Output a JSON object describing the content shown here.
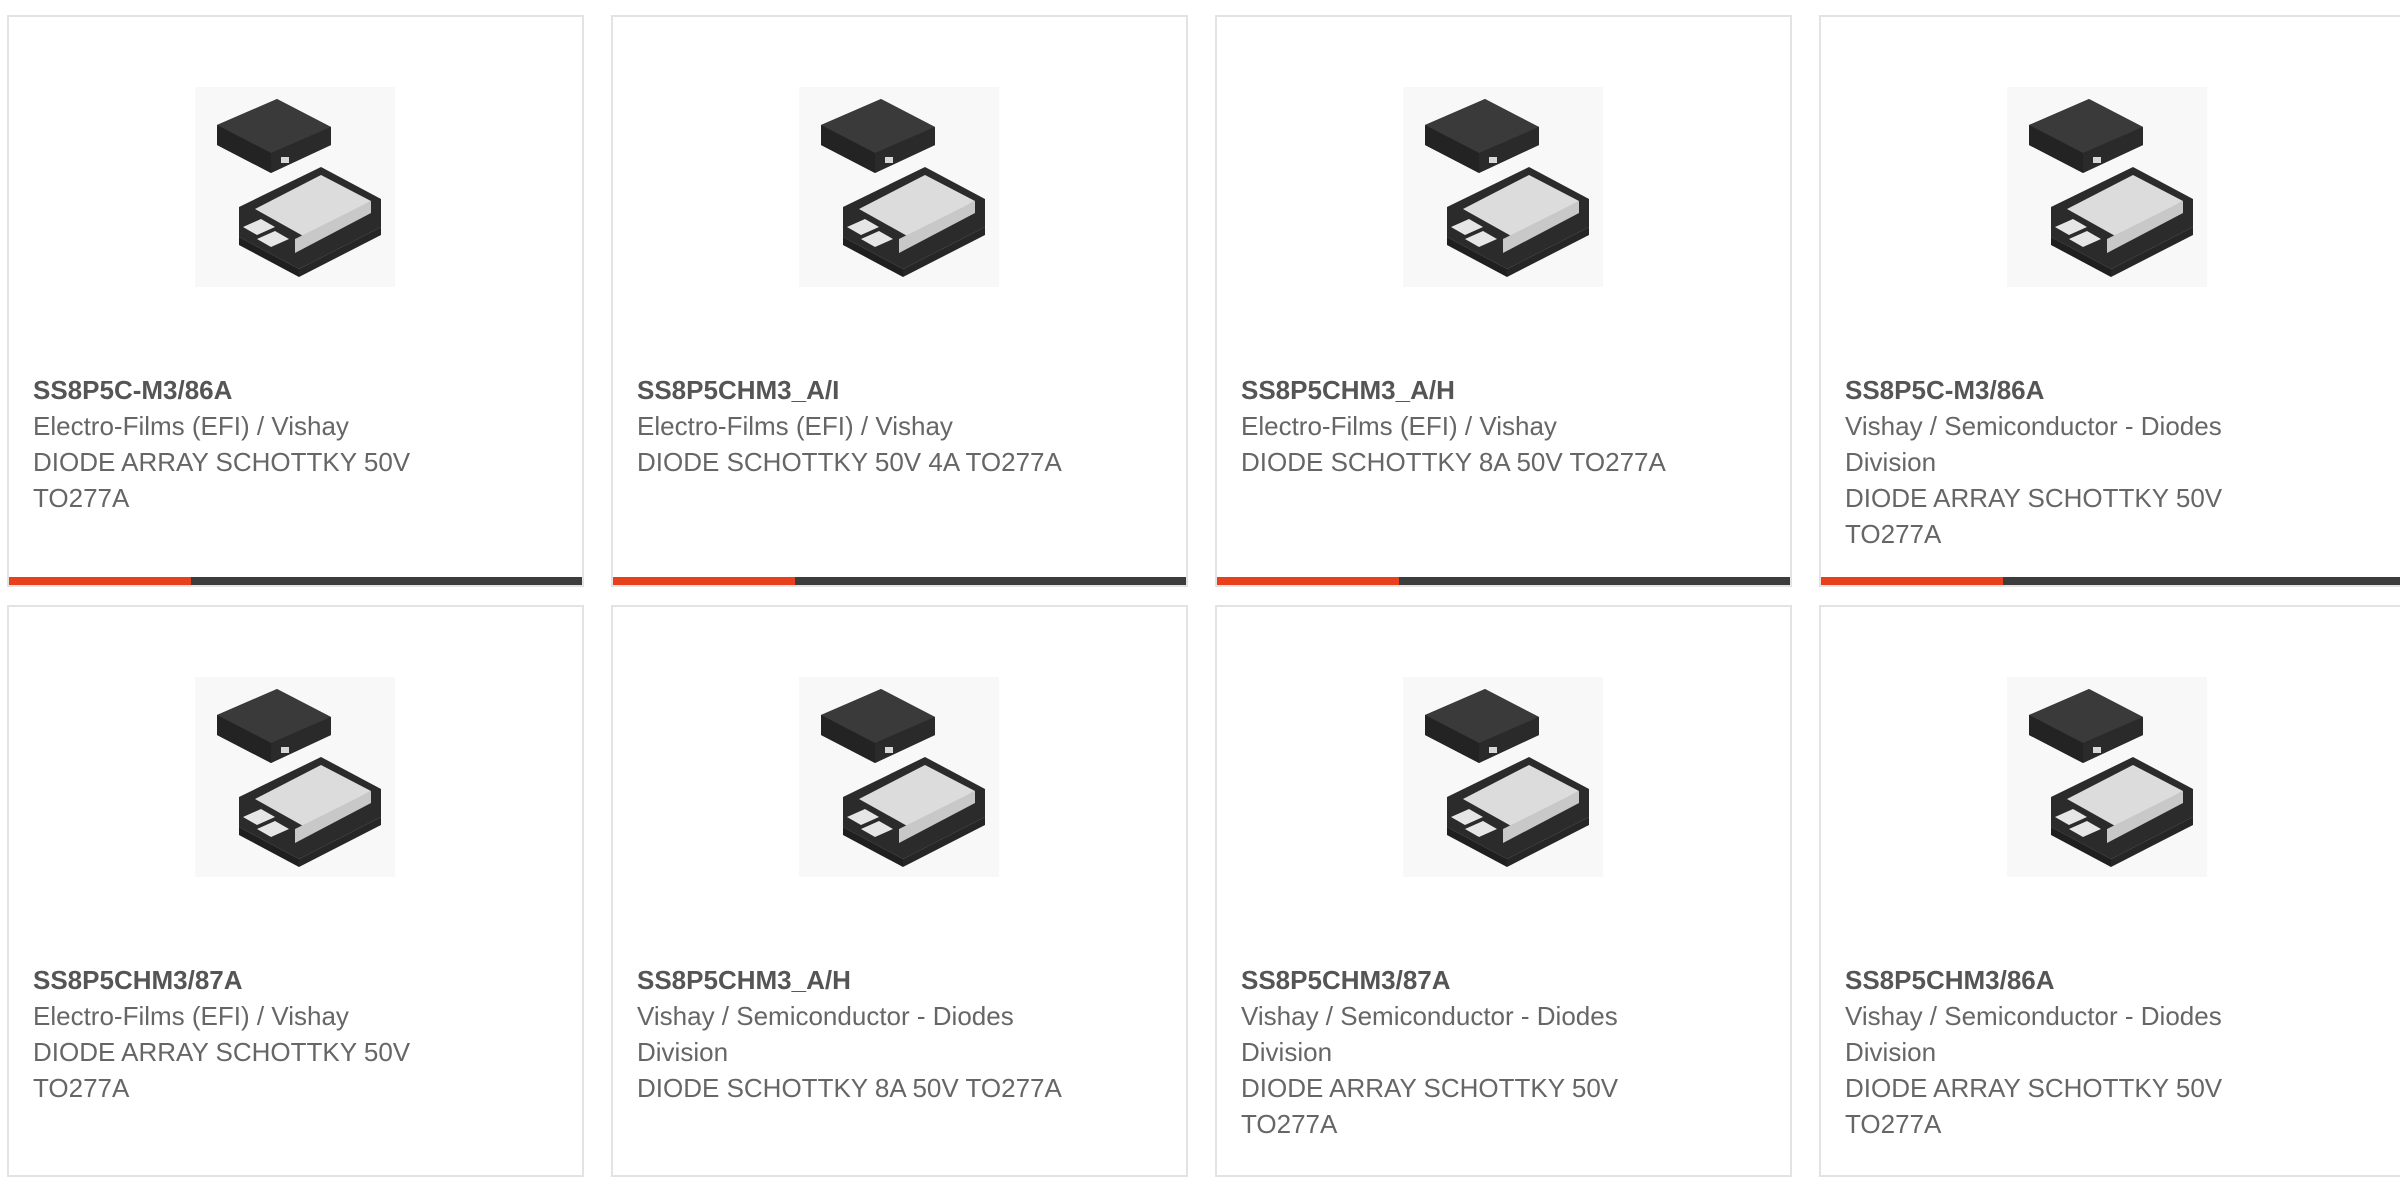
{
  "colors": {
    "accent": "#e8401c",
    "bar_dark": "#3c3c3c",
    "card_border": "#e3e3e3"
  },
  "image_icon": "diode-package-image",
  "cards": [
    {
      "part_number": "SS8P5C-M3/86A",
      "manufacturer": "Electro-Films (EFI) / Vishay",
      "description": "DIODE ARRAY SCHOTTKY 50V TO277A"
    },
    {
      "part_number": "SS8P5CHM3_A/I",
      "manufacturer": "Electro-Films (EFI) / Vishay",
      "description": "DIODE SCHOTTKY 50V 4A TO277A"
    },
    {
      "part_number": "SS8P5CHM3_A/H",
      "manufacturer": "Electro-Films (EFI) / Vishay",
      "description": "DIODE SCHOTTKY 8A 50V TO277A"
    },
    {
      "part_number": "SS8P5C-M3/86A",
      "manufacturer": "Vishay / Semiconductor - Diodes Division",
      "description": "DIODE ARRAY SCHOTTKY 50V TO277A"
    },
    {
      "part_number": "SS8P5CHM3/87A",
      "manufacturer": "Electro-Films (EFI) / Vishay",
      "description": "DIODE ARRAY SCHOTTKY 50V TO277A"
    },
    {
      "part_number": "SS8P5CHM3_A/H",
      "manufacturer": "Vishay / Semiconductor - Diodes Division",
      "description": "DIODE SCHOTTKY 8A 50V TO277A"
    },
    {
      "part_number": "SS8P5CHM3/87A",
      "manufacturer": "Vishay / Semiconductor - Diodes Division",
      "description": "DIODE ARRAY SCHOTTKY 50V TO277A"
    },
    {
      "part_number": "SS8P5CHM3/86A",
      "manufacturer": "Vishay / Semiconductor - Diodes Division",
      "description": "DIODE ARRAY SCHOTTKY 50V TO277A"
    }
  ]
}
